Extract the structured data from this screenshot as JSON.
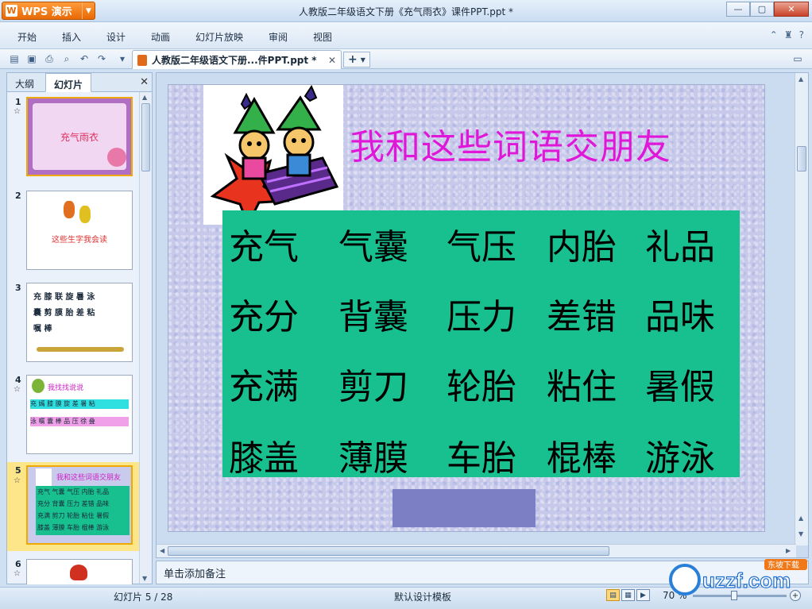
{
  "app": {
    "name": "WPS 演示",
    "window_title": "人教版二年级语文下册《充气雨衣》课件PPT.ppt *"
  },
  "menu": [
    "开始",
    "插入",
    "设计",
    "动画",
    "幻灯片放映",
    "审阅",
    "视图"
  ],
  "doc_tab": {
    "label": "人教版二年级语文下册...件PPT.ppt *"
  },
  "left_panel": {
    "tabs": [
      "大纲",
      "幻灯片"
    ],
    "active_tab": "幻灯片",
    "thumbnails": [
      {
        "num": "1",
        "text": "充气雨衣"
      },
      {
        "num": "2",
        "text": "这些生字我会读"
      },
      {
        "num": "3",
        "lines": [
          "充 膝 联 旋 暑 泳",
          "囊 剪 膜 胎 差 粘",
          "嘱 棒"
        ]
      },
      {
        "num": "4",
        "title": "我找找说说",
        "lines": [
          "充 嫣 膝 膜 旋 差 暑 粘",
          "泳 嘱 囊 棒 品 压 徐 叠"
        ]
      },
      {
        "num": "5",
        "title": "我和这些词语交朋友",
        "lines": [
          "充气 气囊 气压 内胎 礼品",
          "充分 背囊 压力 差错 品味",
          "充满 剪刀 轮胎 粘住 暑假",
          "膝盖 薄膜 车胎 棍棒 游泳"
        ]
      },
      {
        "num": "6"
      }
    ]
  },
  "slide": {
    "title": "我和这些词语交朋友",
    "words": [
      [
        "充气",
        "气囊",
        "气压",
        "内胎",
        "礼品"
      ],
      [
        "充分",
        "背囊",
        "压力",
        "差错",
        "品味"
      ],
      [
        "充满",
        "剪刀",
        "轮胎",
        "粘住",
        "暑假"
      ],
      [
        "膝盖",
        "薄膜",
        "车胎",
        "棍棒",
        "游泳"
      ]
    ]
  },
  "notes": {
    "placeholder": "单击添加备注"
  },
  "status": {
    "slide_indicator": "幻灯片 5 / 28",
    "template": "默认设计模板",
    "zoom": "70 %"
  },
  "watermark": {
    "text": "uzzf.com",
    "tag": "东坡下载"
  },
  "colors": {
    "title_magenta": "#e016d8",
    "grid_green": "#17c08e",
    "box_purple": "#7c7fc3",
    "app_orange": "#e86a06"
  }
}
